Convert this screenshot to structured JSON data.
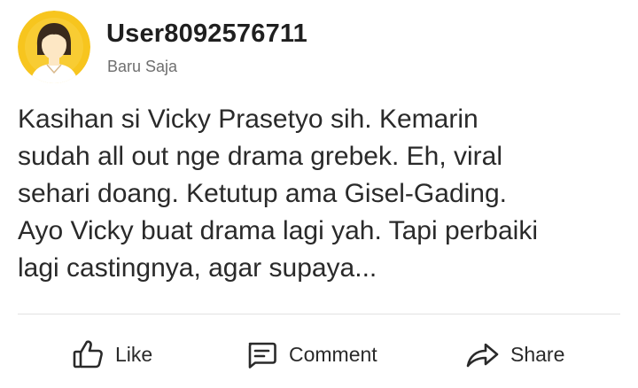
{
  "post": {
    "author": {
      "username": "User8092576711",
      "timestamp": "Baru Saja",
      "avatar_icon": "user-avatar-icon"
    },
    "text_lines": [
      "Kasihan si Vicky Prasetyo sih. Kemarin",
      "sudah all out nge drama grebek. Eh, viral",
      "sehari doang. Ketutup ama Gisel-Gading.",
      "Ayo Vicky buat drama lagi yah. Tapi perbaiki",
      "lagi castingnya, agar supaya..."
    ]
  },
  "actions": {
    "like": {
      "label": "Like",
      "icon": "thumbs-up-icon"
    },
    "comment": {
      "label": "Comment",
      "icon": "comment-icon"
    },
    "share": {
      "label": "Share",
      "icon": "share-arrow-icon"
    }
  },
  "colors": {
    "avatar_bg": "#f7c51e",
    "avatar_face": "#fde7c4",
    "text": "#2a2a2a",
    "muted": "#6f6f6f",
    "divider": "#e2e2e2"
  }
}
